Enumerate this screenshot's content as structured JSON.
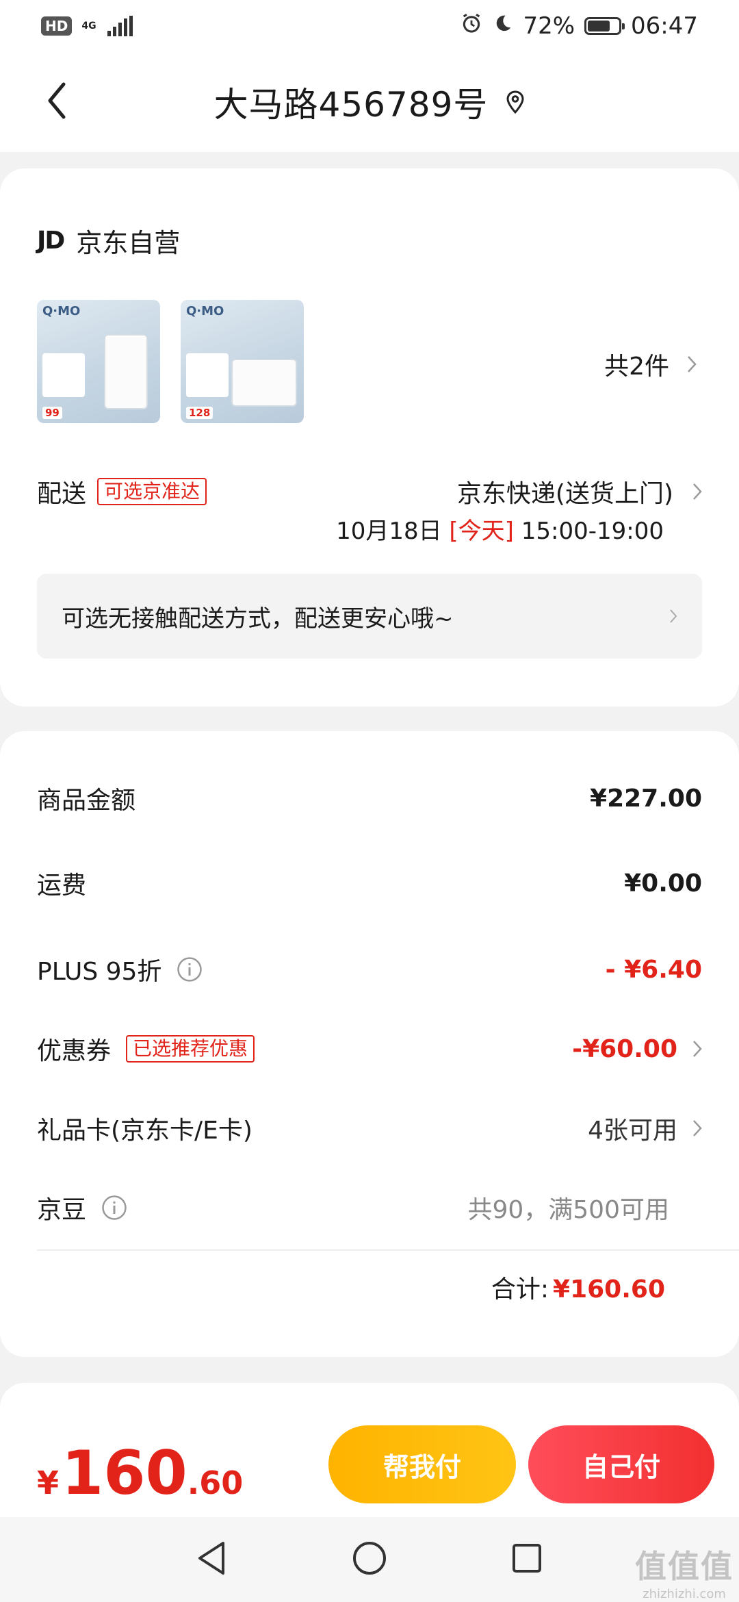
{
  "status": {
    "hd": "HD",
    "network": "4G",
    "battery": "72%",
    "battery_level": 0.72,
    "time": "06:47"
  },
  "header": {
    "title": "大马路456789号"
  },
  "shop": {
    "logo": "JD",
    "name": "京东自营"
  },
  "products": [
    {
      "brand": "Q·MO",
      "price": "99"
    },
    {
      "brand": "Q·MO",
      "price": "128"
    }
  ],
  "items_count": "共2件",
  "delivery": {
    "label": "配送",
    "tag": "可选京准达",
    "method": "京东快递(送货上门)",
    "date": "10月18日",
    "today": "[今天]",
    "time_range": "15:00-19:00"
  },
  "notice": "可选无接触配送方式，配送更安心哦~",
  "fees": {
    "goods_label": "商品金额",
    "goods_value": "¥227.00",
    "shipping_label": "运费",
    "shipping_value": "¥0.00",
    "plus_label": "PLUS 95折",
    "plus_value": "- ¥6.40",
    "coupon_label": "优惠券",
    "coupon_tag": "已选推荐优惠",
    "coupon_value": "-¥60.00",
    "giftcard_label": "礼品卡(京东卡/E卡)",
    "giftcard_value": "4张可用",
    "jingdou_label": "京豆",
    "jingdou_value": "共90，满500可用",
    "total_label": "合计:",
    "total_value": "¥160.60"
  },
  "bottom": {
    "currency": "¥",
    "price_int": "160",
    "price_dec": ".60",
    "help_pay": "帮我付",
    "self_pay": "自己付"
  },
  "watermark": {
    "big": "值值值",
    "small": "zhizhizhi.com"
  },
  "colors": {
    "accent_red": "#e2231a",
    "button_yellow": "#ffb300",
    "button_red": "#f23030"
  }
}
